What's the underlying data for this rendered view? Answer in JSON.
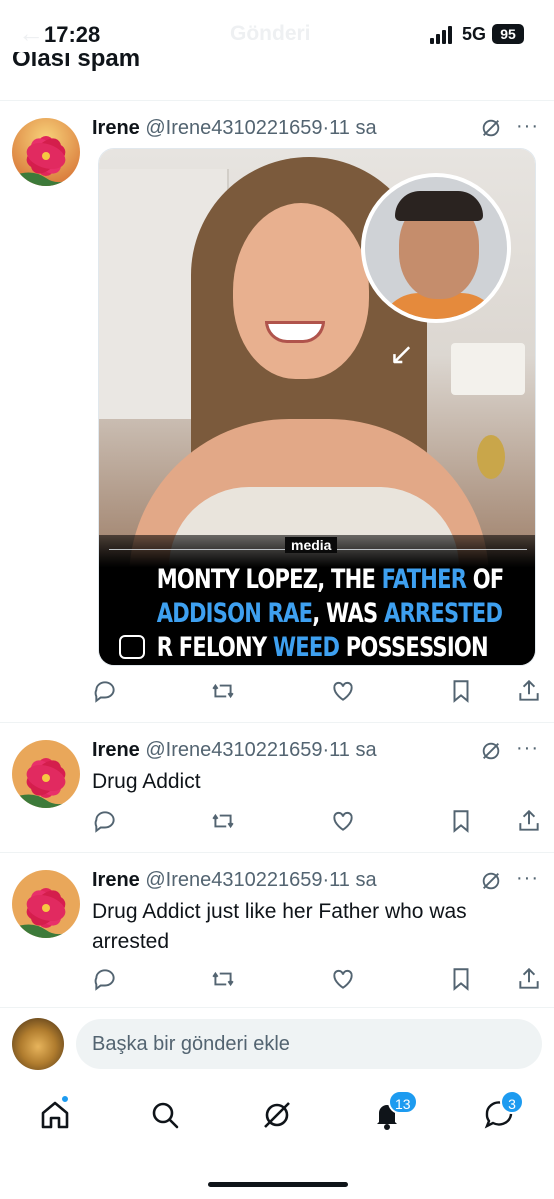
{
  "status_bar": {
    "time": "17:28",
    "network": "5G",
    "battery": "95",
    "ghost_title": "Gönderi"
  },
  "section_header": "Olası spam",
  "posts": [
    {
      "name": "Irene",
      "handle": "@Irene4310221659",
      "time": "11 sa",
      "text": "",
      "media": {
        "brand": "media",
        "headline_parts": [
          "MONTY LOPEZ, THE ",
          "FATHER",
          " OF",
          "ADDISON RAE",
          ", WAS ",
          "ARRESTED",
          "R FELONY ",
          "WEED",
          " POSSESSION"
        ]
      }
    },
    {
      "name": "Irene",
      "handle": "@Irene4310221659",
      "time": "11 sa",
      "text": "Drug Addict"
    },
    {
      "name": "Irene",
      "handle": "@Irene4310221659",
      "time": "11 sa",
      "text": "Drug Addict just like her Father who was arrested"
    }
  ],
  "separator": "·",
  "more": "···",
  "compose": {
    "placeholder": "Başka bir gönderi ekle"
  },
  "tab_bar": {
    "notifications_badge": "13",
    "messages_badge": "3"
  },
  "icons": {
    "reply": "reply-icon",
    "repost": "repost-icon",
    "like": "like-icon",
    "bookmark": "bookmark-icon",
    "share": "share-icon",
    "grok": "grok-icon",
    "home": "home-icon",
    "search": "search-icon",
    "notifications": "bell-icon",
    "messages": "messages-icon"
  },
  "colors": {
    "accent": "#1d9bf0",
    "text_primary": "#0f1419",
    "text_secondary": "#536471",
    "headline_highlight": "#3ea0f0"
  }
}
